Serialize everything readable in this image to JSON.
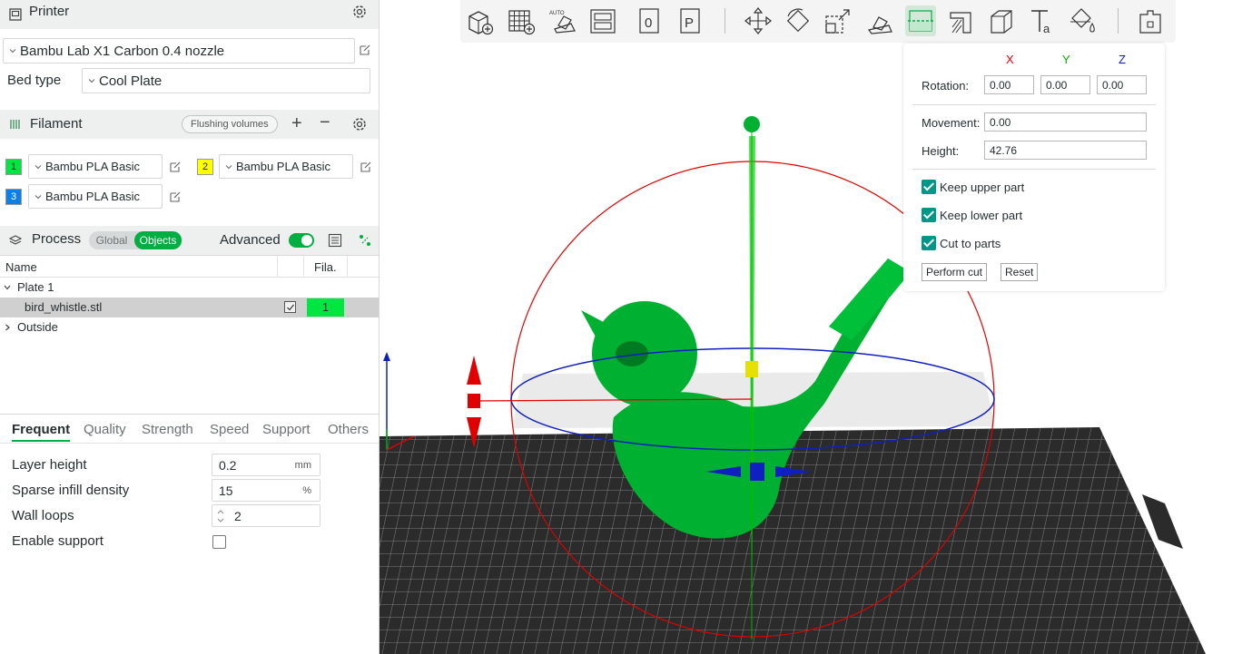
{
  "printer": {
    "section_title": "Printer",
    "name": "Bambu Lab X1 Carbon 0.4 nozzle",
    "bed_type_label": "Bed type",
    "bed_type": "Cool Plate"
  },
  "filament": {
    "section_title": "Filament",
    "flushing_label": "Flushing volumes",
    "items": [
      {
        "index": "1",
        "name": "Bambu PLA Basic",
        "color": "#00e640"
      },
      {
        "index": "2",
        "name": "Bambu PLA Basic",
        "color": "#ffff00"
      },
      {
        "index": "3",
        "name": "Bambu PLA Basic",
        "color": "#0a7fe6"
      }
    ]
  },
  "process": {
    "section_title": "Process",
    "mode_global": "Global",
    "mode_objects": "Objects",
    "advanced_label": "Advanced",
    "advanced_on": true
  },
  "object_list": {
    "col_name": "Name",
    "col_fila": "Fila.",
    "plate": "Plate 1",
    "object": "bird_whistle.stl",
    "object_fila": "1",
    "outside": "Outside"
  },
  "tabs": [
    "Frequent",
    "Quality",
    "Strength",
    "Speed",
    "Support",
    "Others"
  ],
  "params": {
    "layer_height_label": "Layer height",
    "layer_height": "0.2",
    "layer_height_unit": "mm",
    "infill_label": "Sparse infill density",
    "infill": "15",
    "infill_unit": "%",
    "wall_loops_label": "Wall loops",
    "wall_loops": "2",
    "support_label": "Enable support",
    "support_on": false
  },
  "cut_panel": {
    "axis_x": "X",
    "axis_y": "Y",
    "axis_z": "Z",
    "rotation_label": "Rotation:",
    "rot_x": "0.00",
    "rot_y": "0.00",
    "rot_z": "0.00",
    "movement_label": "Movement:",
    "movement": "0.00",
    "height_label": "Height:",
    "height": "42.76",
    "keep_upper": "Keep upper part",
    "keep_lower": "Keep lower part",
    "cut_to_parts": "Cut to parts",
    "perform_cut": "Perform cut",
    "reset": "Reset"
  },
  "colors": {
    "accent": "#00ae42",
    "model": "#00b030",
    "axis_x": "#e00000",
    "axis_y": "#00b000",
    "axis_z": "#1020c0"
  }
}
